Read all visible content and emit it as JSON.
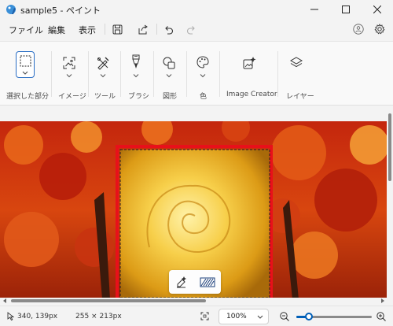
{
  "window": {
    "title": "sample5 - ペイント",
    "icon": "paint-palette-icon",
    "controls": [
      "minimize-icon",
      "maximize-icon",
      "close-icon"
    ]
  },
  "menu": {
    "file": "ファイル",
    "edit": "編集",
    "view": "表示",
    "toolbar_icons": [
      "save-icon",
      "share-icon",
      "undo-icon",
      "redo-icon"
    ],
    "account_icon": "account-icon",
    "settings_icon": "gear-icon"
  },
  "ribbon": {
    "selection": "選択した部分",
    "image": "イメージ",
    "tools": "ツール",
    "brushes": "ブラシ",
    "shapes": "図形",
    "colors": "色",
    "image_creator": "Image Creator",
    "layers": "レイヤー"
  },
  "colors": {
    "accent": "#005fb8",
    "selection_outline": "#e8101a"
  },
  "selection_toolbar": {
    "icons": [
      "remove-background-icon",
      "blur-background-icon"
    ]
  },
  "status": {
    "cursor_pos": "340, 139px",
    "selection_size": "255 × 213px",
    "zoom": "100%",
    "zoom_slider_fraction": 0.17
  }
}
